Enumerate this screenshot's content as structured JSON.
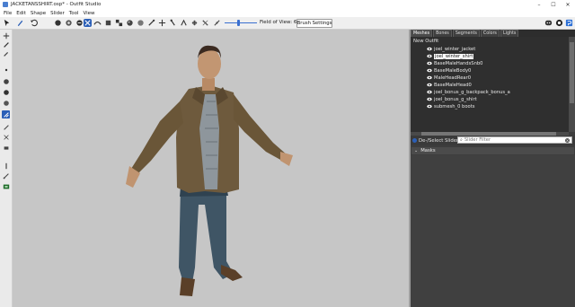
{
  "window": {
    "title": "JACKETANSSHIRT.osp* - Outfit Studio",
    "controls": [
      "–",
      "☐",
      "✕"
    ]
  },
  "menu": [
    "File",
    "Edit",
    "Shape",
    "Slider",
    "Tool",
    "View"
  ],
  "toolbar": {
    "field_of_view_label": "Field of View: 65",
    "brush_settings_label": "Brush Settings"
  },
  "panel": {
    "tabs": [
      "Meshes",
      "Bones",
      "Segments",
      "Colors",
      "Lights"
    ],
    "tree_root": "New Outfit",
    "tree_items": [
      {
        "label": "joel_winter_jacket",
        "selected": false
      },
      {
        "label": "joel_winter_shirt",
        "selected": true
      },
      {
        "label": "BaseMaleHandsSnb0",
        "selected": false
      },
      {
        "label": "BaseMaleBody0",
        "selected": false
      },
      {
        "label": "MaleHeadRear0",
        "selected": false
      },
      {
        "label": "BaseMaleHead0",
        "selected": false
      },
      {
        "label": "joel_bonus_g_backpack_bonus_a",
        "selected": false
      },
      {
        "label": "joel_bonus_g_shirt",
        "selected": false
      },
      {
        "label": "submesh_0 boots",
        "selected": false
      }
    ],
    "deselect_label": "De-/Select Sliders",
    "filter_placeholder": "Slider Filter",
    "masks_label": "Masks"
  },
  "colors": {
    "viewport_bg": "#c6c6c6",
    "panel_bg": "#3d3d3d",
    "accent": "#3a6fd0"
  }
}
